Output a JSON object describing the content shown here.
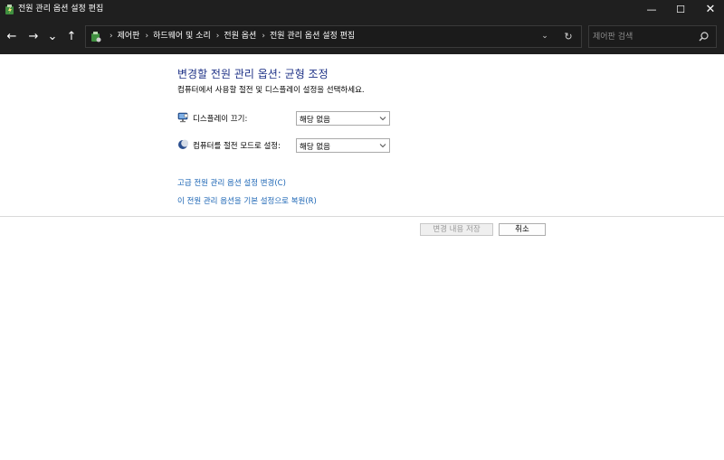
{
  "window": {
    "title": "전원 관리 옵션 설정 편집",
    "controls": {
      "minimize": "—",
      "maximize": "☐",
      "close": "✕"
    }
  },
  "nav": {
    "back_icon": "←",
    "forward_icon": "→",
    "recent_icon": "⌄",
    "up_icon": "↑"
  },
  "address": {
    "crumbs": [
      "제어판",
      "하드웨어 및 소리",
      "전원 옵션",
      "전원 관리 옵션 설정 편집"
    ],
    "separator": "›",
    "dropdown_icon": "⌄",
    "refresh_icon": "↻"
  },
  "search": {
    "placeholder": "제어판 검색"
  },
  "main": {
    "heading": "변경할 전원 관리 옵션: 균형 조정",
    "subtitle": "컴퓨터에서 사용할 절전 및 디스플레이 설정을 선택하세요.",
    "settings": [
      {
        "label": "디스플레이 끄기:",
        "value": "해당 없음",
        "icon": "monitor-icon"
      },
      {
        "label": "컴퓨터를 절전 모드로 설정:",
        "value": "해당 없음",
        "icon": "moon-icon"
      }
    ],
    "links": {
      "advanced": "고급 전원 관리 옵션 설정 변경(C)",
      "restore": "이 전원 관리 옵션을 기본 설정으로 복원(R)"
    },
    "buttons": {
      "save": "변경 내용 저장",
      "cancel": "취소"
    }
  },
  "colors": {
    "titlebar_bg": "#1f1f1f",
    "heading": "#1e3287",
    "link": "#1a64b4"
  }
}
